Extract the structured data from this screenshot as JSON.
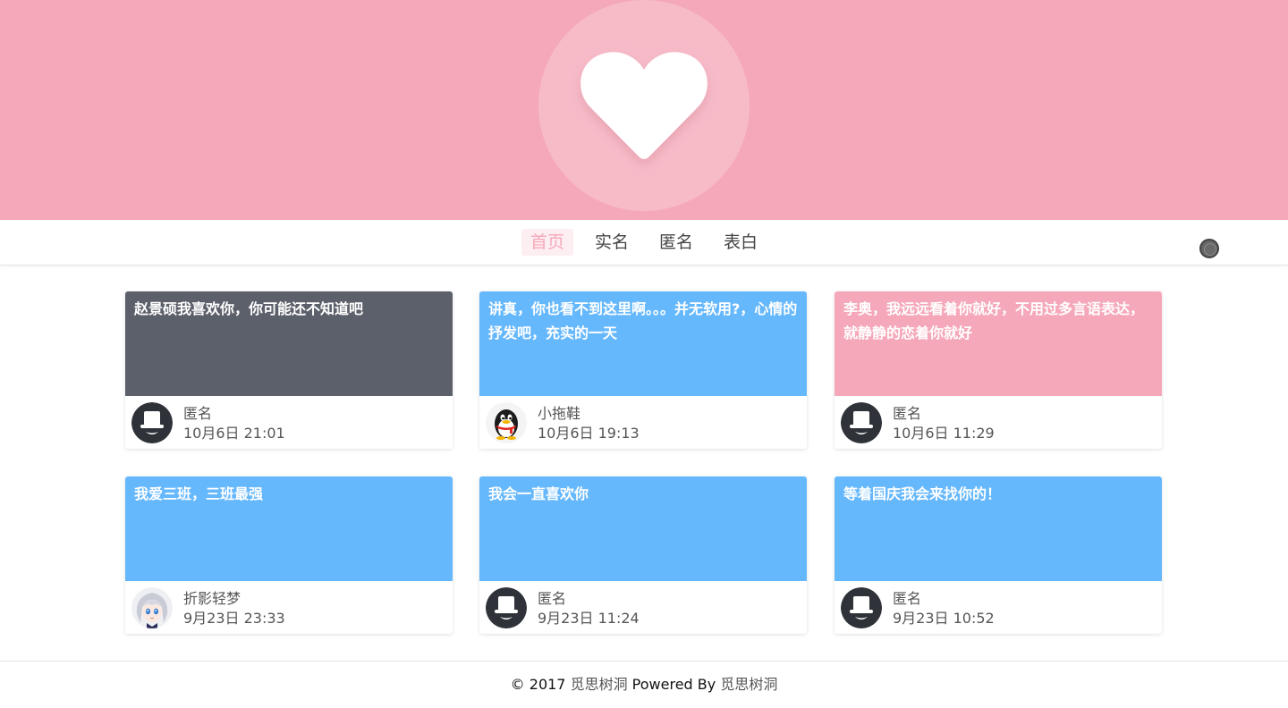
{
  "banner": {
    "color": "#f5a8b9",
    "icon": "heart-icon"
  },
  "nav": {
    "items": [
      {
        "label": "首页",
        "active": true
      },
      {
        "label": "实名",
        "active": false
      },
      {
        "label": "匿名",
        "active": false
      },
      {
        "label": "表白",
        "active": false
      }
    ],
    "toggle_icon": "circle-toggle-icon"
  },
  "posts": [
    {
      "text": "赵景硕我喜欢你，你可能还不知道吧",
      "color": "#5c606a",
      "author": "匿名",
      "time": "10月6日 21:01",
      "avatar": "anonymous-hat-icon"
    },
    {
      "text": "讲真，你也看不到这里啊。。。并无软用?，心情的抒发吧，充实的一天",
      "color": "#66b8fc",
      "author": "小拖鞋",
      "time": "10月6日 19:13",
      "avatar": "qq-penguin-icon"
    },
    {
      "text": "李奥，我远远看着你就好，不用过多言语表达，就静静的恋着你就好",
      "color": "#f5a8b9",
      "author": "匿名",
      "time": "10月6日 11:29",
      "avatar": "anonymous-hat-icon"
    },
    {
      "text": "我爱三班，三班最强",
      "color": "#66b8fc",
      "author": "折影轻梦",
      "time": "9月23日 23:33",
      "avatar": "anime-girl-avatar"
    },
    {
      "text": "我会一直喜欢你",
      "color": "#66b8fc",
      "author": "匿名",
      "time": "9月23日 11:24",
      "avatar": "anonymous-hat-icon"
    },
    {
      "text": "等着国庆我会来找你的！",
      "color": "#66b8fc",
      "author": "匿名",
      "time": "9月23日 10:52",
      "avatar": "anonymous-hat-icon"
    }
  ],
  "footer": {
    "copyright": "© 2017 ",
    "site_link": "觅思树洞",
    "powered": " Powered By ",
    "powered_link": "觅思树洞"
  }
}
